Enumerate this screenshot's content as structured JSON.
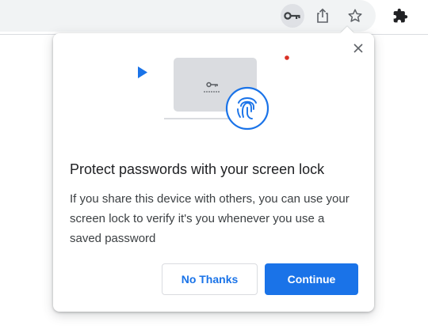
{
  "toolbar": {
    "icons": [
      "key-icon",
      "share-icon",
      "star-icon",
      "extensions-icon"
    ]
  },
  "dialog": {
    "title": "Protect passwords with your screen lock",
    "body": "If you share this device with others, you can use your screen lock to verify it's you whenever you use a saved password",
    "close_icon": "close-icon",
    "secondary_button": "No Thanks",
    "primary_button": "Continue"
  },
  "colors": {
    "accent": "#1a73e8",
    "text_primary": "#202124",
    "text_secondary": "#3c4043",
    "illustration_gray": "#dadce0",
    "red_dot": "#d93025"
  }
}
